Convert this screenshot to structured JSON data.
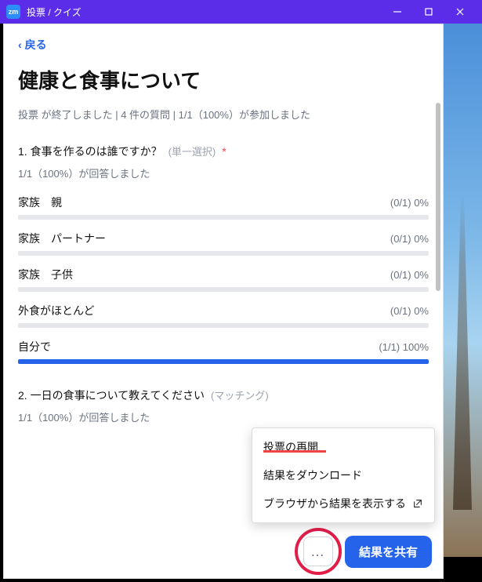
{
  "titlebar": {
    "icon_text": "zm",
    "title": "投票 / クイズ"
  },
  "back": {
    "label": "戻る"
  },
  "poll": {
    "title": "健康と食事について",
    "meta": "投票 が終了しました | 4 件の質問 | 1/1（100%）が参加しました"
  },
  "q1": {
    "title": "1. 食事を作るのは誰ですか？",
    "type": "(単一選択)",
    "required": "*",
    "respondents": "1/1（100%）が回答しました",
    "options": [
      {
        "label": "家族　親",
        "stats": "(0/1) 0%",
        "pct": 0
      },
      {
        "label": "家族　パートナー",
        "stats": "(0/1) 0%",
        "pct": 0
      },
      {
        "label": "家族　子供",
        "stats": "(0/1) 0%",
        "pct": 0
      },
      {
        "label": "外食がほとんど",
        "stats": "(0/1) 0%",
        "pct": 0
      },
      {
        "label": "自分で",
        "stats": "(1/1) 100%",
        "pct": 100
      }
    ]
  },
  "q2": {
    "title": "2. 一日の食事について教えてください",
    "type": "(マッチング)",
    "respondents": "1/1（100%）が回答しました"
  },
  "footer": {
    "more": "…",
    "share": "結果を共有"
  },
  "menu": {
    "reopen": "投票の再開",
    "download": "結果をダウンロード",
    "browser": "ブラウザから結果を表示する"
  }
}
